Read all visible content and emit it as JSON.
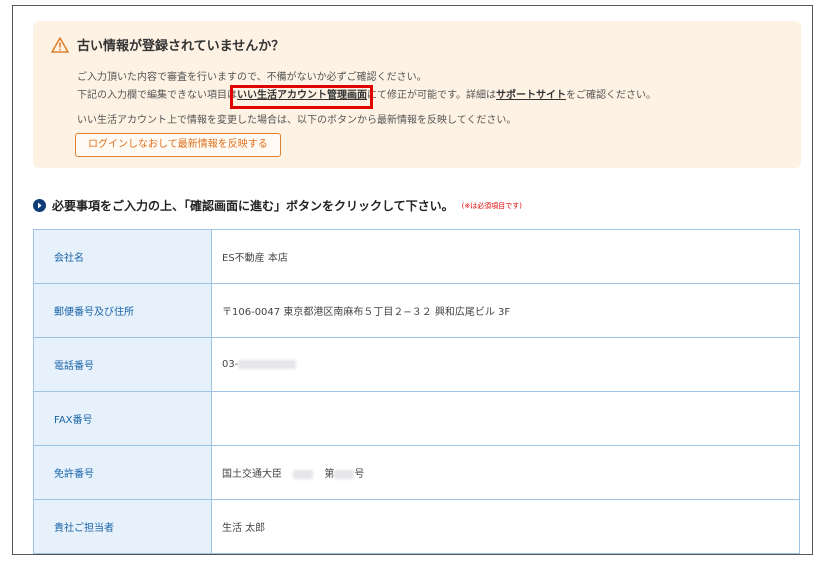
{
  "notice": {
    "title": "古い情報が登録されていませんか？",
    "line1": "ご入力頂いた内容で審査を行いますので、不備がないか必ずご確認ください。",
    "line2_pre": "下記の入力欄で編集できない項目は",
    "line2_link1": "いい生活アカウント管理画面",
    "line2_mid": "にて修正が可能です。詳細は",
    "line2_link2": "サポートサイト",
    "line2_post": "をご確認ください。",
    "line3": "いい生活アカウント上で情報を変更した場合は、以下のボタンから最新情報を反映してください。",
    "button_label": "ログインしなおして最新情報を反映する"
  },
  "section": {
    "heading": "必要事項をご入力の上、「確認画面に進む」ボタンをクリックして下さい。",
    "required_note": "(※は必須項目です)"
  },
  "form": {
    "company": {
      "label": "会社名",
      "value": "ES不動産 本店"
    },
    "address": {
      "label": "郵便番号及び住所",
      "value": "〒106-0047 東京都港区南麻布５丁目２−３２ 興和広尾ビル 3F"
    },
    "phone": {
      "label": "電話番号",
      "value_prefix": "03-"
    },
    "fax": {
      "label": "FAX番号"
    },
    "license": {
      "label": "免許番号",
      "value_prefix": "国土交通大臣",
      "value_mid": "第",
      "value_suffix": "号"
    },
    "person": {
      "label": "貴社ご担当者",
      "value": "生活 太郎"
    }
  },
  "colors": {
    "notice_bg": "#fdf2e4",
    "label_bg": "#e6f1fb",
    "label_text": "#1a64a8",
    "accent_orange": "#e0701f",
    "highlight_red": "#e00000"
  }
}
